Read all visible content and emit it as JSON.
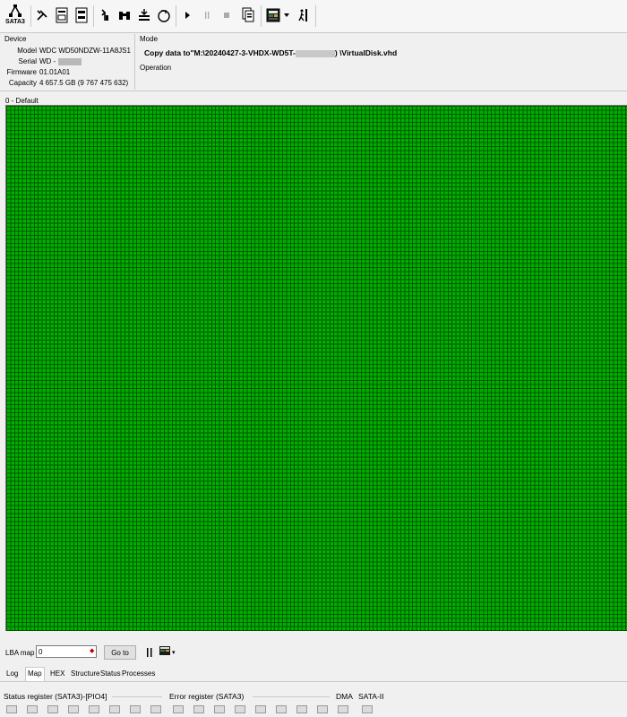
{
  "toolbar": {
    "sata_label": "SATA3",
    "icons": [
      "hdd-port-icon",
      "tools-icon",
      "smart-report-icon",
      "percent-report-icon",
      "extract-icon",
      "binoculars-icon",
      "copy-layers-icon",
      "disk-arrow-icon",
      "play-icon",
      "pause-icon",
      "stop-icon",
      "copy-pages-icon",
      "map-icon",
      "dropdown-icon",
      "exit-icon"
    ]
  },
  "device": {
    "legend": "Device",
    "model_label": "Model",
    "model_value": "WDC WD50NDZW-11A8JS1",
    "serial_label": "Serial",
    "serial_value": "WD -",
    "firmware_label": "Firmware",
    "firmware_value": "01.01A01",
    "capacity_label": "Capacity",
    "capacity_value": "4 657.5 GB (9 767 475 632)"
  },
  "mode": {
    "legend": "Mode",
    "text_prefix": "Copy data to\"M:\\20240427-3-VHDX-WD5T-",
    "text_suffix": ")  \\VirtualDisk.vhd",
    "operation_legend": "Operation"
  },
  "map": {
    "label": "0 - Default",
    "block_color": "#00b000"
  },
  "lba": {
    "label": "LBA map",
    "value": "0",
    "goto_label": "Go to"
  },
  "tabs": [
    {
      "label": "Log"
    },
    {
      "label": "Map"
    },
    {
      "label": "HEX"
    },
    {
      "label": "Structure"
    },
    {
      "label": "Status"
    },
    {
      "label": "Processes"
    }
  ],
  "active_tab": "Map",
  "status": {
    "status_register_label": "Status register (SATA3)-[PIO4]",
    "error_register_label": "Error register (SATA3)",
    "dma_label": "DMA",
    "sata2_label": "SATA-II"
  }
}
